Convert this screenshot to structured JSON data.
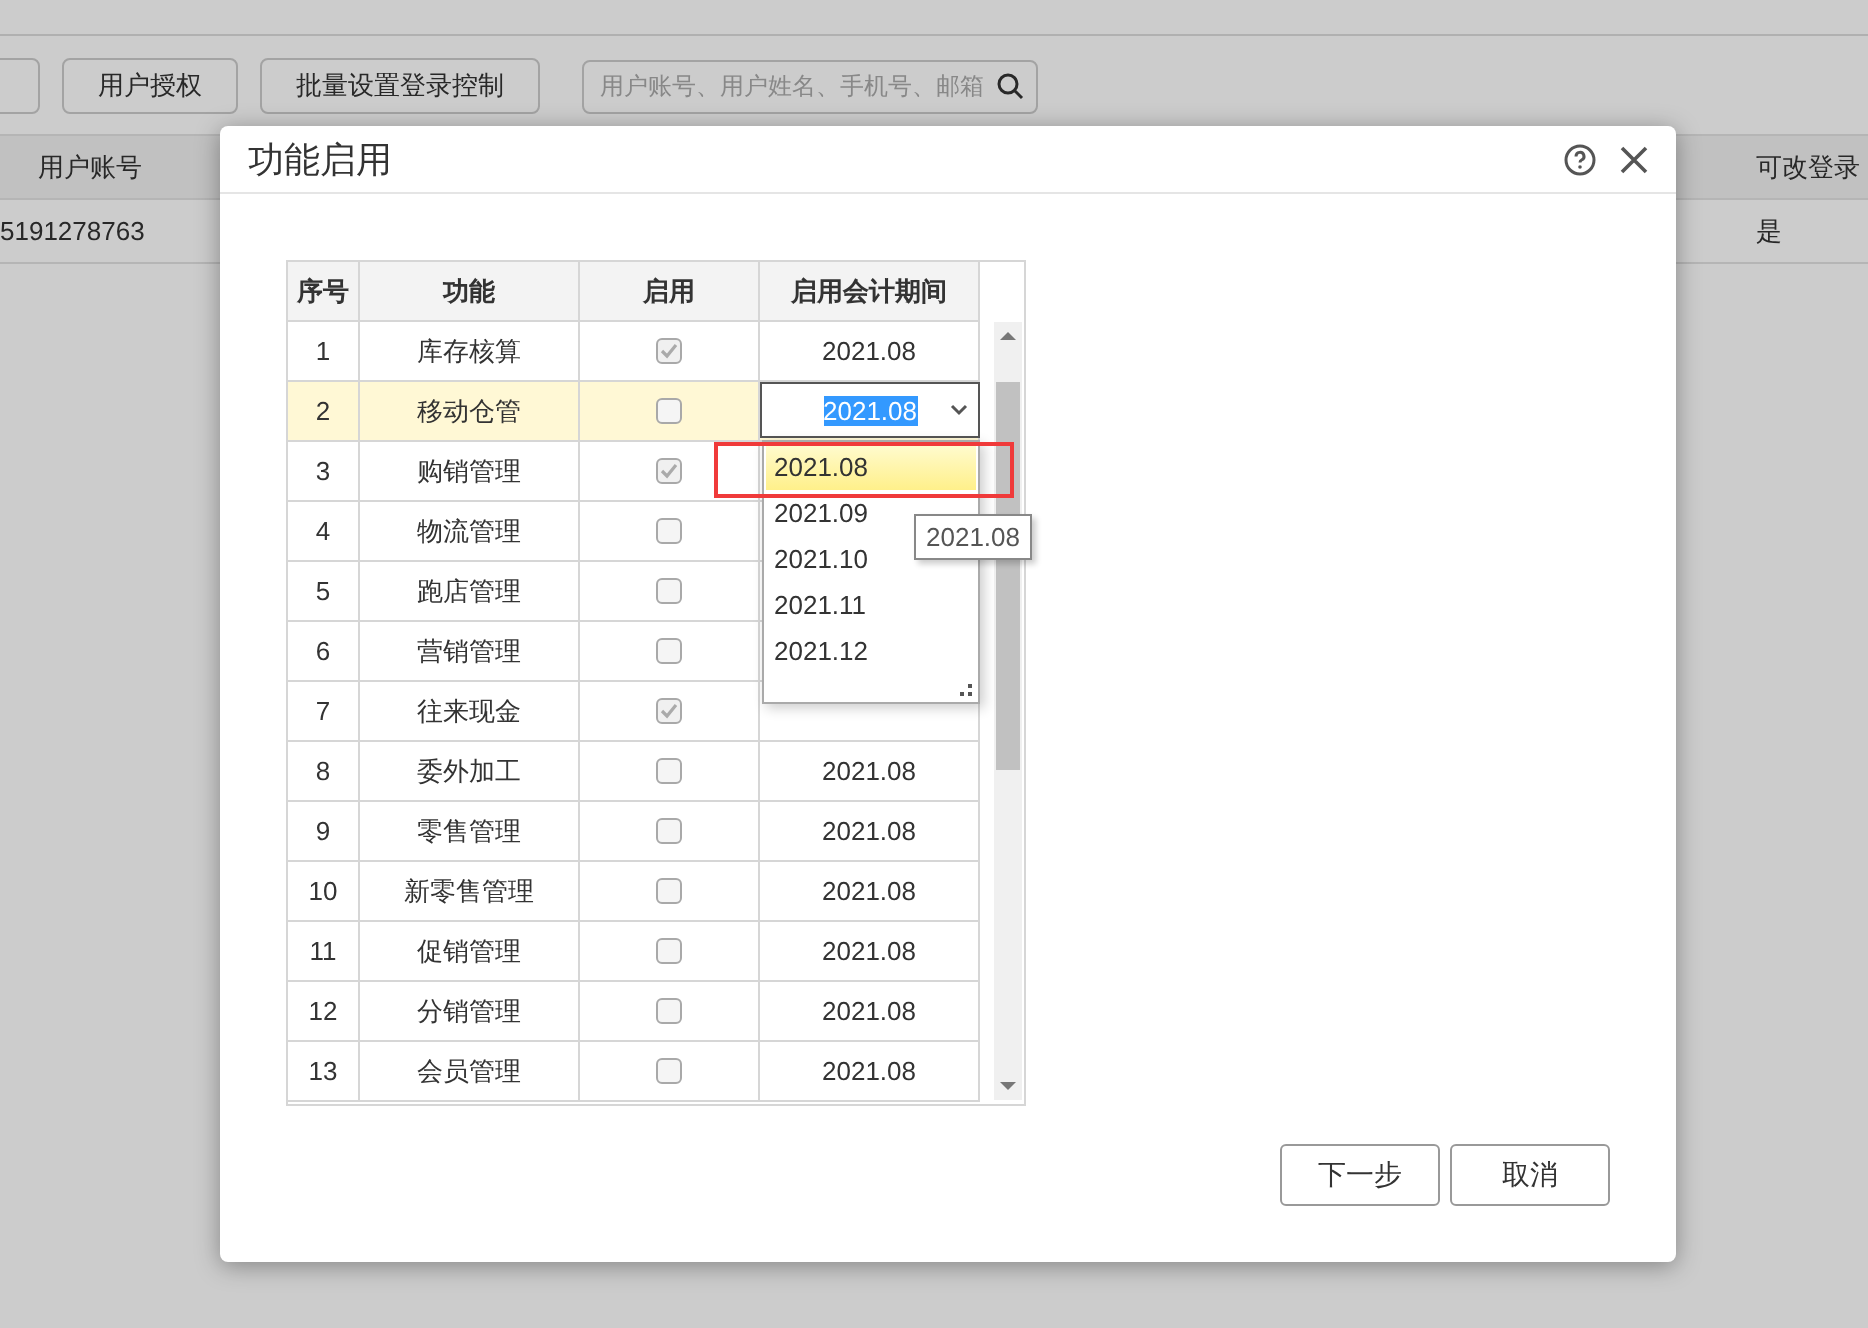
{
  "page": {
    "toolbar": [
      "用户授权",
      "批量设置登录控制"
    ],
    "search": {
      "placeholder": "用户账号、用户姓名、手机号、邮箱"
    },
    "columns": [
      "用户账号",
      "可改登录"
    ],
    "row": [
      "5191278763",
      "是"
    ]
  },
  "dialog": {
    "title": "功能启用",
    "columns": [
      "序号",
      "功能",
      "启用",
      "启用会计期间"
    ],
    "functions": [
      {
        "no": "1",
        "name": "库存核算",
        "enabled": true,
        "selected": false,
        "period": "2021.08"
      },
      {
        "no": "2",
        "name": "移动仓管",
        "enabled": false,
        "selected": true,
        "period": "2021.08",
        "editing": true
      },
      {
        "no": "3",
        "name": "购销管理",
        "enabled": true,
        "selected": false
      },
      {
        "no": "4",
        "name": "物流管理",
        "enabled": false,
        "selected": false
      },
      {
        "no": "5",
        "name": "跑店管理",
        "enabled": false,
        "selected": false
      },
      {
        "no": "6",
        "name": "营销管理",
        "enabled": false,
        "selected": false
      },
      {
        "no": "7",
        "name": "往来现金",
        "enabled": true,
        "selected": false
      },
      {
        "no": "8",
        "name": "委外加工",
        "enabled": false,
        "selected": false,
        "period": "2021.08"
      },
      {
        "no": "9",
        "name": "零售管理",
        "enabled": false,
        "selected": false,
        "period": "2021.08"
      },
      {
        "no": "10",
        "name": "新零售管理",
        "enabled": false,
        "selected": false,
        "period": "2021.08"
      },
      {
        "no": "11",
        "name": "促销管理",
        "enabled": false,
        "selected": false,
        "period": "2021.08"
      },
      {
        "no": "12",
        "name": "分销管理",
        "enabled": false,
        "selected": false,
        "period": "2021.08"
      },
      {
        "no": "13",
        "name": "会员管理",
        "enabled": false,
        "selected": false,
        "period": "2021.08"
      }
    ],
    "period_dropdown": {
      "options": [
        {
          "label": "2021.08",
          "selected": true
        },
        {
          "label": "2021.09",
          "selected": false
        },
        {
          "label": "2021.10",
          "selected": false
        },
        {
          "label": "2021.11",
          "selected": false
        },
        {
          "label": "2021.12",
          "selected": false
        }
      ],
      "tooltip": "2021.08"
    },
    "buttons": [
      "下一步",
      "取消"
    ]
  }
}
